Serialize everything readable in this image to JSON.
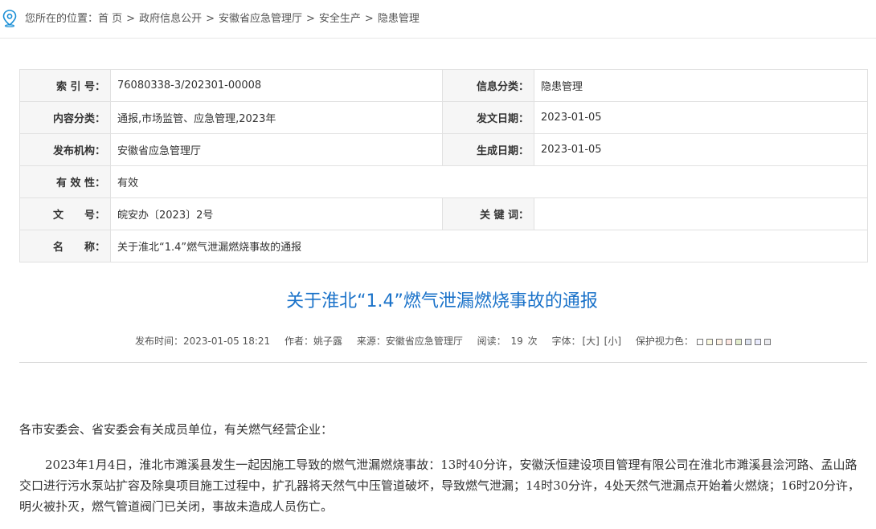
{
  "breadcrumb": {
    "prefix": "您所在的位置：",
    "items": [
      "首 页",
      "政府信息公开",
      "安徽省应急管理厅",
      "安全生产",
      "隐患管理"
    ],
    "separator": ">"
  },
  "info": {
    "index_label": "索 引 号：",
    "index_value": "76080338-3/202301-00008",
    "category_label": "信息分类：",
    "category_value": "隐患管理",
    "content_label": "内容分类：",
    "content_value": "通报,市场监管、应急管理,2023年",
    "issue_date_label": "发文日期：",
    "issue_date_value": "2023-01-05",
    "publisher_label": "发布机构：",
    "publisher_value": "安徽省应急管理厅",
    "create_date_label": "生成日期：",
    "create_date_value": "2023-01-05",
    "validity_label": "有 效 性：",
    "validity_value": "有效",
    "docno_label": "文　　号：",
    "docno_value": "皖安办〔2023〕2号",
    "keywords_label": "关 键 词：",
    "keywords_value": "",
    "name_label": "名　　称：",
    "name_value": "关于淮北“1.4”燃气泄漏燃烧事故的通报"
  },
  "article": {
    "title": "关于淮北“1.4”燃气泄漏燃烧事故的通报",
    "publish_time": "发布时间：2023-01-05 18:21",
    "author": "作者：姚子露",
    "source": "来源：安徽省应急管理厅",
    "reads_label": "阅读：",
    "reads_count": "19",
    "reads_unit": "次",
    "font_label": "字体：",
    "font_large": "[大]",
    "font_small": "[小]",
    "eyecare_label": "保护视力色：",
    "swatch_colors": [
      "#ffffff",
      "#faf9de",
      "#fff2e2",
      "#fde6e0",
      "#e3edcd",
      "#dce2f1",
      "#e9ebfe",
      "#eaeaef"
    ],
    "greeting": "各市安委会、省安委会有关成员单位，有关燃气经营企业：",
    "paragraph1": "2023年1月4日，淮北市濉溪县发生一起因施工导致的燃气泄漏燃烧事故：13时40分许，安徽沃恒建设项目管理有限公司在淮北市濉溪县浍河路、孟山路交口进行污水泵站扩容及除臭项目施工过程中，扩孔器将天然气中压管道破坏，导致燃气泄漏；14时30分许，4处天然气泄漏点开始着火燃烧；16时20分许，明火被扑灭，燃气管道阀门已关闭，事故未造成人员伤亡。"
  },
  "colors": {
    "title": "#1a72c9",
    "pin": "#1a8fd6",
    "label_bg": "#f6f6f6",
    "border": "#e1e1e1"
  }
}
